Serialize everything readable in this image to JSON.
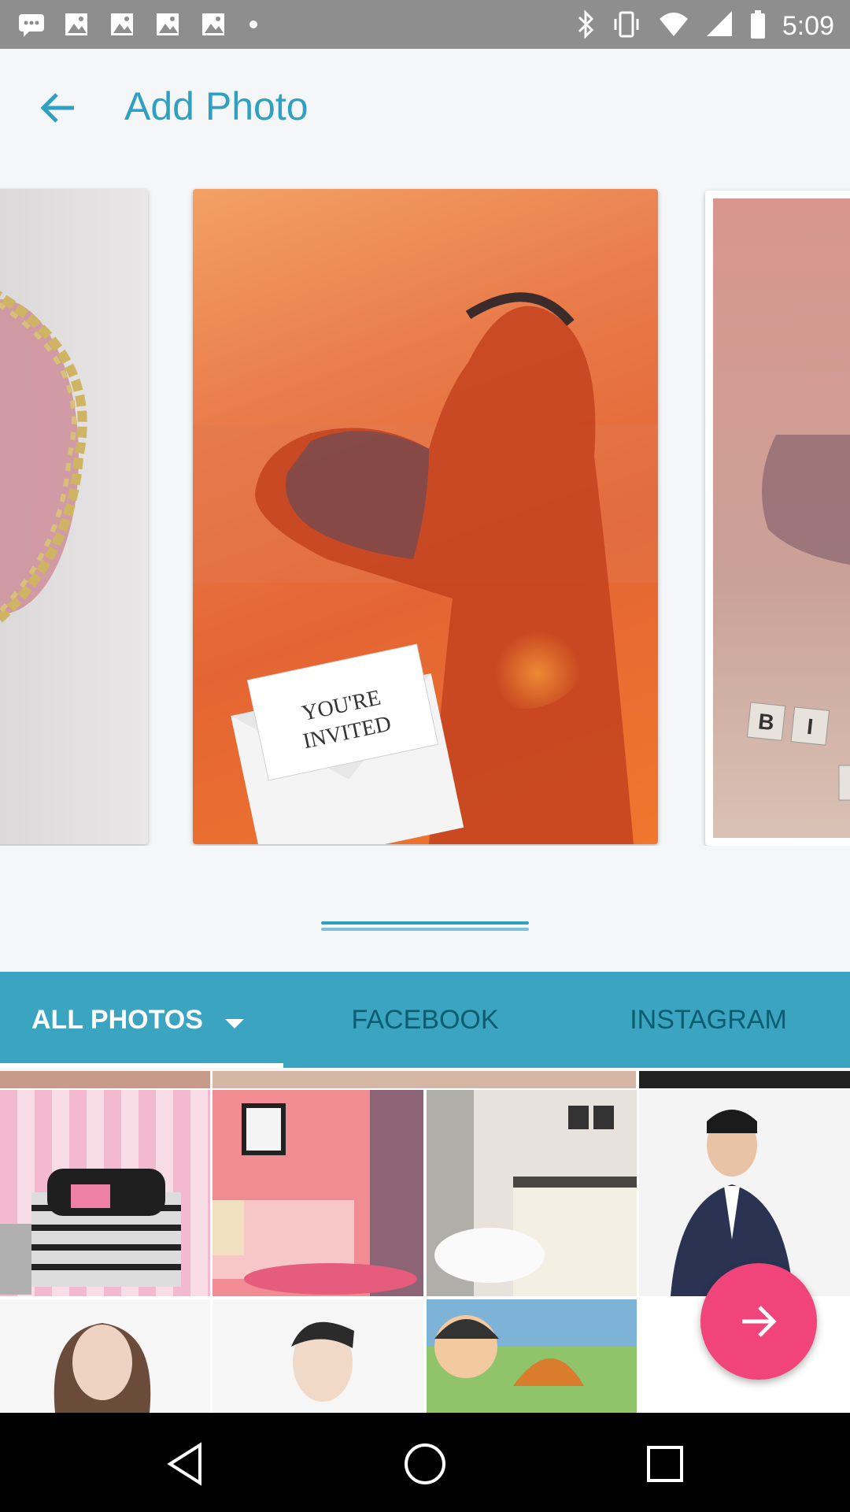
{
  "status_bar": {
    "time": "5:09",
    "left_icons": [
      "messages-icon",
      "image-icon",
      "image-icon",
      "image-icon",
      "image-icon",
      "dot-icon"
    ],
    "right_icons": [
      "bluetooth-icon",
      "vibrate-icon",
      "wifi-icon",
      "signal-icon",
      "battery-icon"
    ]
  },
  "app_bar": {
    "back_icon": "arrow-back-icon",
    "title": "Add Photo"
  },
  "carousel": {
    "cards": [
      {
        "name": "wreath-template",
        "label": ""
      },
      {
        "name": "invitation-template",
        "label": "YOU'RE INVITED"
      },
      {
        "name": "birthday-template",
        "label": "B I"
      }
    ]
  },
  "tabs": [
    {
      "label": "ALL PHOTOS",
      "active": true
    },
    {
      "label": "FACEBOOK",
      "active": false
    },
    {
      "label": "INSTAGRAM",
      "active": false
    }
  ],
  "grid": {
    "photos": [
      {
        "name": "pink-bedroom-photo"
      },
      {
        "name": "barbie-room-photo"
      },
      {
        "name": "bathroom-photo"
      },
      {
        "name": "man-in-suit-photo"
      },
      {
        "name": "woman-portrait-photo"
      },
      {
        "name": "young-man-photo"
      },
      {
        "name": "cartoon-photo"
      }
    ]
  },
  "fab": {
    "icon": "arrow-forward-icon"
  },
  "nav_bar": {
    "icons": [
      "back-icon",
      "home-icon",
      "recents-icon"
    ]
  },
  "colors": {
    "accent": "#2fa0bf",
    "tab_bar": "#3ba4c0",
    "fab": "#f0447a",
    "status_bar": "#8e8e8e"
  }
}
